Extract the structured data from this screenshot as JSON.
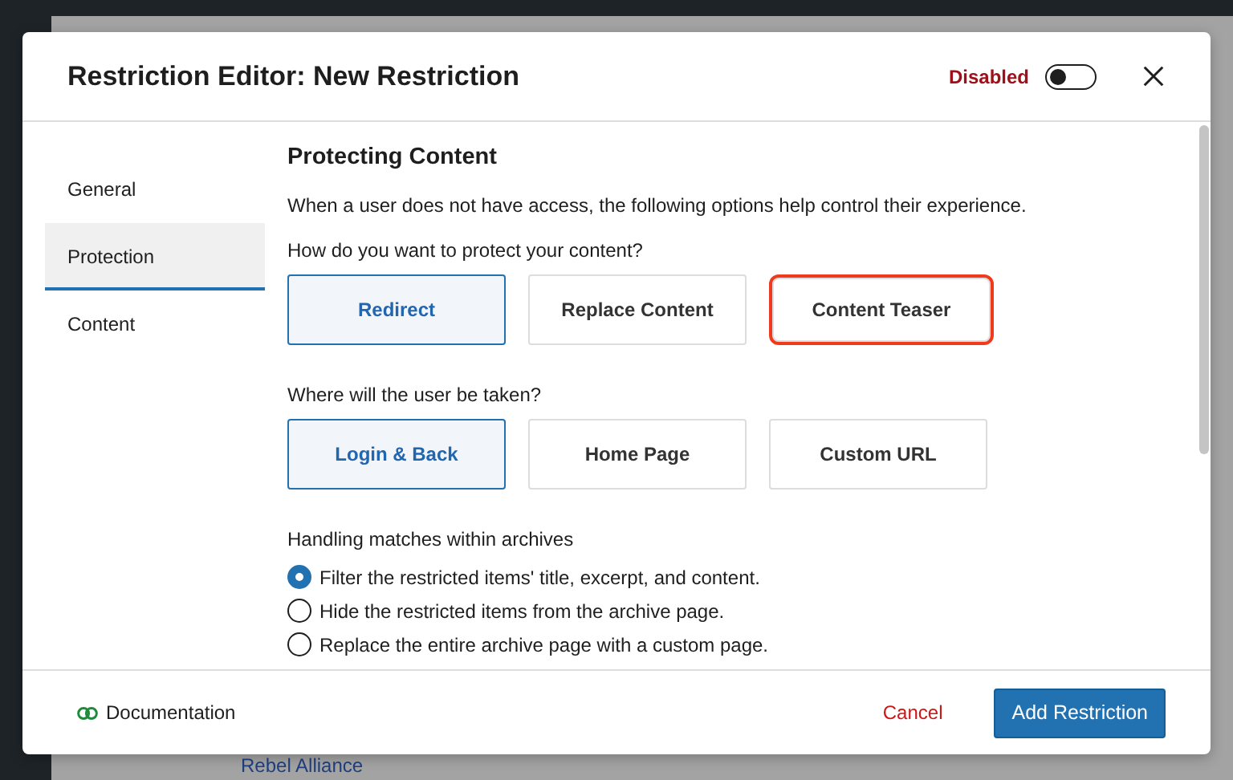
{
  "background": {
    "link": "Rebel Alliance"
  },
  "window": {
    "title": "Restriction Editor: New Restriction",
    "status_label": "Disabled",
    "enabled": false
  },
  "sidebar": {
    "items": [
      {
        "label": "General",
        "selected": false
      },
      {
        "label": "Protection",
        "selected": true
      },
      {
        "label": "Content",
        "selected": false
      }
    ]
  },
  "section": {
    "title": "Protecting Content",
    "description": "When a user does not have access, the following options help control their experience."
  },
  "protection_method": {
    "question": "How do you want to protect your content?",
    "options": [
      {
        "label": "Redirect",
        "selected": true,
        "highlighted": false
      },
      {
        "label": "Replace Content",
        "selected": false,
        "highlighted": false
      },
      {
        "label": "Content Teaser",
        "selected": false,
        "highlighted": true
      }
    ]
  },
  "redirect_target": {
    "question": "Where will the user be taken?",
    "options": [
      {
        "label": "Login & Back",
        "selected": true
      },
      {
        "label": "Home Page",
        "selected": false
      },
      {
        "label": "Custom URL",
        "selected": false
      }
    ]
  },
  "archives": {
    "question": "Handling matches within archives",
    "options": [
      {
        "label": "Filter the restricted items' title, excerpt, and content.",
        "selected": true
      },
      {
        "label": "Hide the restricted items from the archive page.",
        "selected": false
      },
      {
        "label": "Replace the entire archive page with a custom page.",
        "selected": false
      }
    ]
  },
  "footer": {
    "documentation": "Documentation",
    "cancel": "Cancel",
    "submit": "Add Restriction"
  }
}
